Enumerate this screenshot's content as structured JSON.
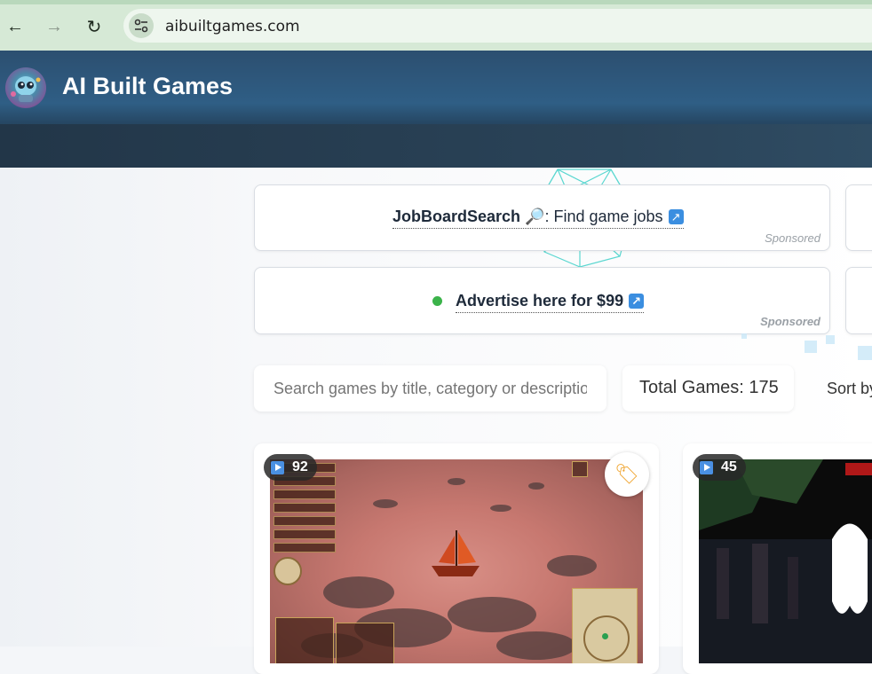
{
  "browser": {
    "url": "aibuiltgames.com",
    "back_icon": "←",
    "forward_icon": "→",
    "reload_icon": "↻"
  },
  "site": {
    "title": "AI Built Games"
  },
  "ads": [
    {
      "brand": "JobBoardSearch",
      "emoji": "🔎",
      "text": ": Find game jobs",
      "ext": "↗",
      "sponsored": "Sponsored"
    },
    {
      "text": "Advertise here for $99",
      "ext": "↗",
      "sponsored": "Sponsored"
    }
  ],
  "toolbar": {
    "search_placeholder": "Search games by title, category or description",
    "total_games": "Total Games: 175",
    "sort_label": "Sort by"
  },
  "games": [
    {
      "plays": "92",
      "tag_icon": "🏷"
    },
    {
      "plays": "45"
    }
  ],
  "colors": {
    "accent": "#3b8ee0",
    "header": "#2c4f70",
    "online_dot": "#3bb34a"
  }
}
